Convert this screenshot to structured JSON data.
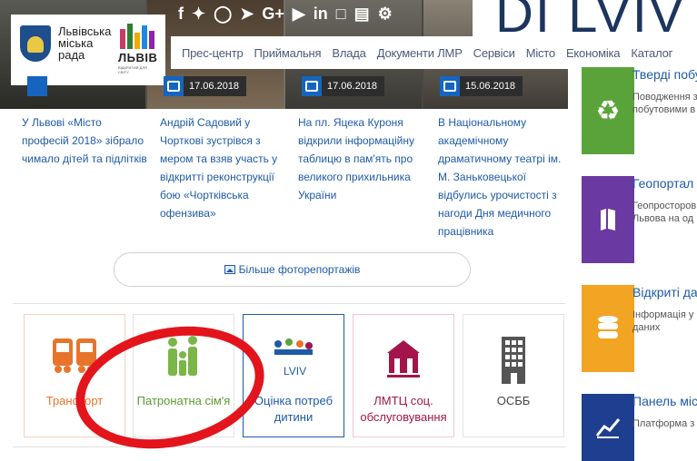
{
  "header": {
    "city_council_name": "Львівська міська рада",
    "city_logo_word": "ЛЬВІВ",
    "city_logo_tagline": "ВІДКРИТИЙ ДЛЯ СВІТУ",
    "di_lviv_text": "DI LVIV",
    "social_icons": [
      "facebook-icon",
      "twitter-icon",
      "instagram-icon",
      "telegram-icon",
      "google-plus-icon",
      "youtube-icon",
      "linkedin-icon",
      "flickr-icon",
      "rss-icon",
      "vk-icon"
    ],
    "nav": [
      "Прес-центр",
      "Приймальня",
      "Влада",
      "Документи ЛМР",
      "Сервіси",
      "Місто",
      "Економіка",
      "Каталог"
    ]
  },
  "news": [
    {
      "date": "",
      "caption": "У Львові «Місто професій 2018» зібрало чимало дітей та підлітків"
    },
    {
      "date": "17.06.2018",
      "caption": "Андрій Садовий у Чорткові зустрівся з мером та взяв участь у відкритті реконструкції бою «Чортківська офензива»"
    },
    {
      "date": "17.06.2018",
      "caption": "На пл. Яцека Куроня відкрили інформаційну таблицю в пам'ять про великого прихильника України"
    },
    {
      "date": "15.06.2018",
      "caption": "В Національному академічному драматичному театрі ім. М. Заньковецької відбулись урочистості з нагоди Дня медичного працівника"
    }
  ],
  "more_button": "Більше фоторепортажів",
  "tiles": [
    {
      "label": "Транспорт",
      "color": "#e8742b",
      "icon": "bus-icon"
    },
    {
      "label": "Патронатна сім'я",
      "color": "#7ab648",
      "icon": "family-icon"
    },
    {
      "label": "Оцінка потреб дитини",
      "color": "#1e5aa8",
      "icon": "lviv-child-icon"
    },
    {
      "label": "ЛМТЦ соц. обслуговування",
      "color": "#a3154a",
      "icon": "social-center-icon"
    },
    {
      "label": "ОСББ",
      "color": "#444444",
      "icon": "building-icon"
    }
  ],
  "cards": [
    {
      "title": "Тверді побу",
      "desc": "Поводження з\nпобутовими в",
      "color": "#5aa33a",
      "icon": "recycle-icon"
    },
    {
      "title": "Геопортал Л",
      "desc": "Геопросторов\nЛьвова на од",
      "color": "#6a3aa2",
      "icon": "map-icon"
    },
    {
      "title": "Відкриті да",
      "desc": "Інформація у\nданих",
      "color": "#f2a423",
      "icon": "database-icon"
    },
    {
      "title": "Панель міс",
      "desc": "Платформа з",
      "color": "#1e3f8f",
      "icon": "chart-line-icon"
    }
  ]
}
